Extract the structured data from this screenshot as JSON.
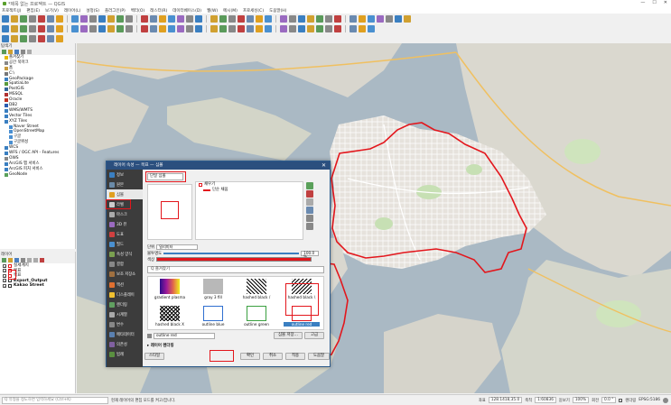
{
  "window": {
    "title": "*제목 없는 프로젝트 — QGIS",
    "controls": [
      "—",
      "☐",
      "✕"
    ]
  },
  "menu": [
    "프로젝트(J)",
    "편집(E)",
    "보기(V)",
    "레이어(L)",
    "설정(S)",
    "플러그인(P)",
    "벡터(O)",
    "래스터(R)",
    "데이터베이스(D)",
    "웹(W)",
    "메시(M)",
    "프로세싱(C)",
    "도움말(H)"
  ],
  "browser": {
    "title": "탐색기",
    "items": [
      {
        "label": "즐겨찾기",
        "icon": "star-icon",
        "color": "#e6b800",
        "indent": 1
      },
      {
        "label": "공간 북마크",
        "icon": "bookmark-icon",
        "color": "#888888",
        "indent": 1
      },
      {
        "label": "홈",
        "icon": "home-icon",
        "color": "#c79a3c",
        "indent": 1
      },
      {
        "label": "C:\\",
        "icon": "drive-icon",
        "color": "#777777",
        "indent": 1
      },
      {
        "label": "GeoPackage",
        "icon": "geopackage-icon",
        "color": "#3a7fc1",
        "indent": 1
      },
      {
        "label": "SpatiaLite",
        "icon": "spatialite-icon",
        "color": "#5a9b3c",
        "indent": 1
      },
      {
        "label": "PostGIS",
        "icon": "postgis-icon",
        "color": "#336699",
        "indent": 1
      },
      {
        "label": "MSSQL",
        "icon": "mssql-icon",
        "color": "#b03030",
        "indent": 1
      },
      {
        "label": "Oracle",
        "icon": "oracle-icon",
        "color": "#c03020",
        "indent": 1
      },
      {
        "label": "DB2",
        "icon": "db2-icon",
        "color": "#2a5db0",
        "indent": 1
      },
      {
        "label": "WMS/WMTS",
        "icon": "wms-icon",
        "color": "#3a7fc1",
        "indent": 1
      },
      {
        "label": "Vector Tiles",
        "icon": "vector-tiles-icon",
        "color": "#3a7fc1",
        "indent": 1
      },
      {
        "label": "XYZ Tiles",
        "icon": "xyz-tiles-icon",
        "color": "#3a7fc1",
        "indent": 1
      },
      {
        "label": "Naver Street",
        "icon": "tile-layer-icon",
        "color": "#4a8fd1",
        "indent": 2
      },
      {
        "label": "OpenStreetMap",
        "icon": "tile-layer-icon",
        "color": "#4a8fd1",
        "indent": 2
      },
      {
        "label": "구글",
        "icon": "tile-layer-icon",
        "color": "#4a8fd1",
        "indent": 2
      },
      {
        "label": "구글위성",
        "icon": "tile-layer-icon",
        "color": "#4a8fd1",
        "indent": 2
      },
      {
        "label": "WCS",
        "icon": "wcs-icon",
        "color": "#3a7fc1",
        "indent": 1
      },
      {
        "label": "WFS / OGC API - Features",
        "icon": "wfs-icon",
        "color": "#3a7fc1",
        "indent": 1
      },
      {
        "label": "OWS",
        "icon": "ows-icon",
        "color": "#888888",
        "indent": 1
      },
      {
        "label": "ArcGIS 맵 서비스",
        "icon": "arcgis-icon",
        "color": "#3a7fc1",
        "indent": 1
      },
      {
        "label": "ArcGIS 피처 서비스",
        "icon": "arcgis-icon",
        "color": "#3a7fc1",
        "indent": 1
      },
      {
        "label": "GeoNode",
        "icon": "geonode-icon",
        "color": "#5aa05a",
        "indent": 1
      }
    ]
  },
  "layers": {
    "title": "레이어",
    "items": [
      {
        "label": "실세계지",
        "checked": true,
        "bold": false,
        "color": "#e3161c"
      },
      {
        "label": "목표",
        "checked": true,
        "bold": false,
        "color": "#e3161c"
      },
      {
        "label": "목표",
        "checked": true,
        "bold": false,
        "color": "#e3161c"
      },
      {
        "label": "Export_Output",
        "checked": true,
        "bold": true,
        "color": "#333333"
      },
      {
        "label": "Kakao Street",
        "checked": true,
        "bold": true,
        "color": "#333333"
      }
    ]
  },
  "statusbar": {
    "search_placeholder": "Q 유형을 정도하면 입력하세요 (Ctrl+K)",
    "message": "현재 레이어의 편집 모드를 켜고/끕니다.",
    "coord_label": "좌표",
    "coord_value": "128.1418,35.0",
    "scale_label": "축척",
    "scale_value": "1:60836",
    "magnifier_label": "돋보기",
    "magnifier_value": "100%",
    "rotation_label": "회전",
    "rotation_value": "0.0 °",
    "render_label": "렌더링",
    "crs_label": "EPSG:5186"
  },
  "dialog": {
    "title": "레이어 속성 — 목표 — 심볼",
    "close": "✕",
    "sidebar": [
      {
        "label": "정보",
        "icon": "info-icon",
        "color": "#3a7fc1",
        "active": false
      },
      {
        "label": "원본",
        "icon": "source-icon",
        "color": "#6a8aa8",
        "active": false
      },
      {
        "label": "심볼",
        "icon": "symbology-icon",
        "color": "#e0a020",
        "active": true
      },
      {
        "label": "라벨",
        "icon": "labels-icon",
        "color": "#cccccc",
        "active": false
      },
      {
        "label": "마스크",
        "icon": "mask-icon",
        "color": "#aaaaaa",
        "active": false
      },
      {
        "label": "3D 뷰",
        "icon": "3d-view-icon",
        "color": "#9a6ac0",
        "active": false
      },
      {
        "label": "도표",
        "icon": "diagrams-icon",
        "color": "#d04040",
        "active": false
      },
      {
        "label": "필드",
        "icon": "fields-icon",
        "color": "#4a90d0",
        "active": false
      },
      {
        "label": "속성 양식",
        "icon": "attributes-form-icon",
        "color": "#7aa050",
        "active": false
      },
      {
        "label": "결합",
        "icon": "joins-icon",
        "color": "#888888",
        "active": false
      },
      {
        "label": "보조 저장소",
        "icon": "auxiliary-storage-icon",
        "color": "#a07040",
        "active": false
      },
      {
        "label": "액션",
        "icon": "actions-icon",
        "color": "#e07030",
        "active": false
      },
      {
        "label": "디스플레이",
        "icon": "display-icon",
        "color": "#f0c030",
        "active": false
      },
      {
        "label": "렌더링",
        "icon": "rendering-icon",
        "color": "#60a060",
        "active": false
      },
      {
        "label": "시계열",
        "icon": "temporal-icon",
        "color": "#aaaaaa",
        "active": false
      },
      {
        "label": "변수",
        "icon": "variables-icon",
        "color": "#888888",
        "active": false
      },
      {
        "label": "메타데이터",
        "icon": "metadata-icon",
        "color": "#5a80b0",
        "active": false
      },
      {
        "label": "의존성",
        "icon": "dependencies-icon",
        "color": "#8060a0",
        "active": false
      },
      {
        "label": "범례",
        "icon": "legend-icon",
        "color": "#5a9040",
        "active": false
      }
    ],
    "renderer": "단일 심볼",
    "tree": [
      {
        "label": "채우기",
        "indent": 0
      },
      {
        "label": "단순 채움",
        "indent": 1
      }
    ],
    "unit_label": "단위",
    "unit_value": "밀리미터",
    "opacity_label": "불투명도",
    "opacity_value": "100.0 %",
    "color_label": "색상",
    "color_value": "#e3161c",
    "lib_search": "Q 즐겨찾기",
    "library": [
      {
        "label": "gradient  plasma",
        "kind": "gradient"
      },
      {
        "label": "gray 3 fill",
        "kind": "gray"
      },
      {
        "label": "hashed black /",
        "kind": "hashed"
      },
      {
        "label": "hashed black \\",
        "kind": "hashed2"
      },
      {
        "label": "hashed black X",
        "kind": "crosshatch"
      },
      {
        "label": "outline blue",
        "kind": "outline",
        "color": "#2f6fd0"
      },
      {
        "label": "outline green",
        "kind": "outline",
        "color": "#3aa040"
      },
      {
        "label": "outline red",
        "kind": "outline",
        "color": "#e3161c"
      }
    ],
    "selected_symbol": "outline red",
    "save_symbol": "심볼 저장…",
    "advanced": "고급",
    "layer_render": "레이어 렌더링",
    "style": "스타일",
    "ok": "확인",
    "cancel": "취소",
    "apply": "적용",
    "help": "도움말"
  }
}
